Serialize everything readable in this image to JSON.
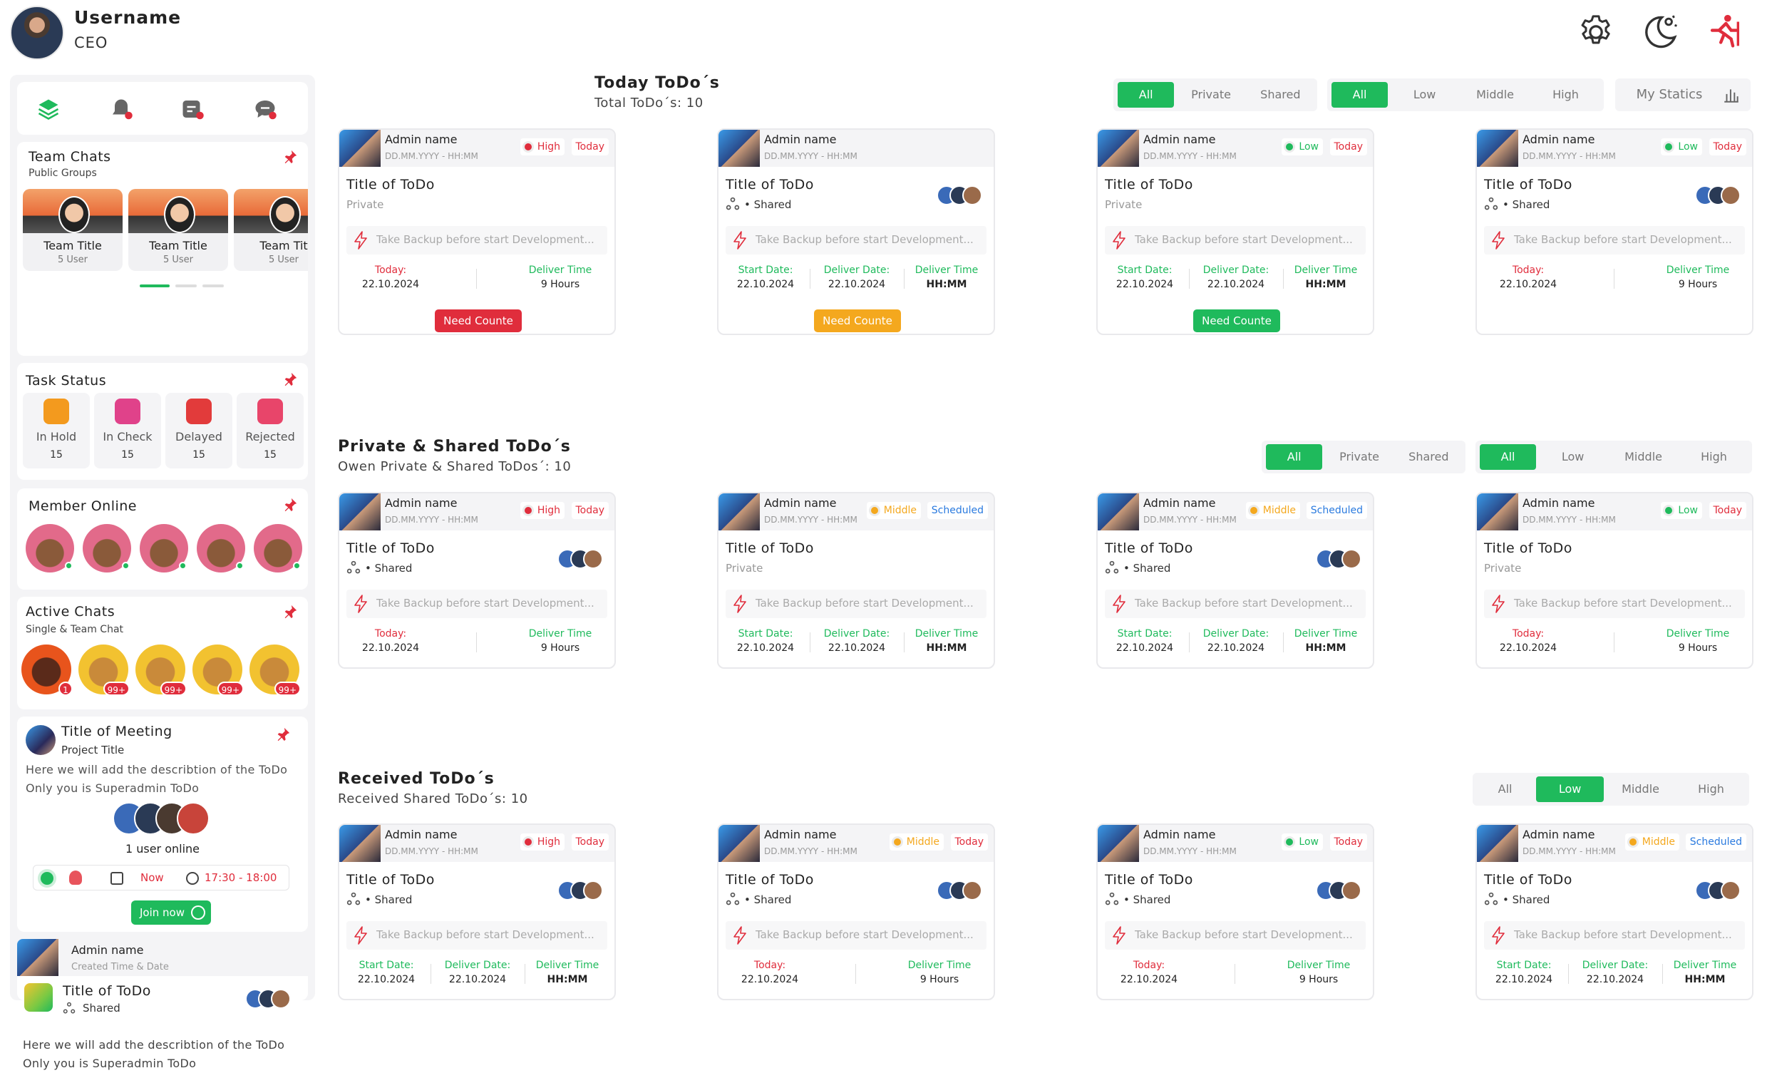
{
  "user": {
    "name": "Username",
    "role": "CEO"
  },
  "top_icons": [
    "gear-icon",
    "moon-theme-icon",
    "logout-run-icon"
  ],
  "sidebar": {
    "nav_icons": [
      "layers-icon",
      "bell-icon",
      "tasks-icon",
      "chat-icon"
    ],
    "team_chats": {
      "title": "Team Chats",
      "subtitle": "Public Groups",
      "cards": [
        {
          "title": "Team Title",
          "users": "5 User"
        },
        {
          "title": "Team Title",
          "users": "5 User"
        },
        {
          "title": "Team Tit",
          "users": "5 User"
        }
      ]
    },
    "task_status": {
      "title": "Task Status",
      "items": [
        {
          "label": "In Hold",
          "count": "15",
          "color": "#f39a1e"
        },
        {
          "label": "In Check",
          "count": "15",
          "color": "#e0428a"
        },
        {
          "label": "Delayed",
          "count": "15",
          "color": "#e23b3b"
        },
        {
          "label": "Rejected",
          "count": "15",
          "color": "#e8456a"
        }
      ]
    },
    "member_online": {
      "title": "Member Online"
    },
    "active_chats": {
      "title": "Active Chats",
      "subtitle": "Single & Team Chat",
      "badges": [
        "1",
        "99+",
        "99+",
        "99+",
        "99+"
      ]
    },
    "meeting": {
      "title": "Title of Meeting",
      "subtitle": "Project Title",
      "description": "Here we will add the describtion of the ToDo Only you is Superadmin ToDo",
      "online": "1 user online",
      "when": "Now",
      "time": "17:30 - 18:00",
      "join_label": "Join now"
    },
    "todo_preview": {
      "admin": "Admin name",
      "created": "Created Time & Date",
      "title": "Title of ToDo",
      "shared": "Shared",
      "description": "Here we will add the describtion of the ToDo Only you is Superadmin ToDo"
    }
  },
  "labels": {
    "admin": "Admin name",
    "date_placeholder": "DD.MM.YYYY - HH:MM",
    "todo_title": "Title of ToDo",
    "private": "Private",
    "shared": "Shared",
    "task": "Take Backup before start Development...",
    "today_k": "Today:",
    "start_k": "Start Date:",
    "deliver_date_k": "Deliver Date:",
    "deliver_time_k": "Deliver Time",
    "date_v": "22.10.2024",
    "hours_v": "9 Hours",
    "hhmm_v": "HH:MM"
  },
  "colors": {
    "green": "#1fba5c",
    "red": "#e02d3c",
    "orange": "#f4a81e",
    "blue": "#2a7adf"
  },
  "today_section": {
    "title": "Today ToDo´s",
    "subtitle": "Total ToDo´s: 10",
    "filter_scope": [
      "All",
      "Private",
      "Shared"
    ],
    "filter_priority": [
      "All",
      "Low",
      "Middle",
      "High"
    ],
    "statics_label": "My Statics",
    "cards": [
      {
        "priority": "High",
        "tag": "Today",
        "visibility": "Private",
        "dates": "today",
        "button": "Need Counte",
        "button_color": "#e02d3c"
      },
      {
        "priority": "",
        "tag": "",
        "visibility": "Shared",
        "dates": "range",
        "button": "Need Counte",
        "button_color": "#f4a81e"
      },
      {
        "priority": "Low",
        "tag": "Today",
        "visibility": "Private",
        "dates": "range",
        "button": "Need Counte",
        "button_color": "#1fba5c"
      },
      {
        "priority": "Low",
        "tag": "Today",
        "visibility": "Shared",
        "dates": "today",
        "button": ""
      }
    ]
  },
  "private_section": {
    "title": "Private & Shared  ToDo´s",
    "subtitle": "Owen Private & Shared ToDos´: 10",
    "filter_scope": [
      "All",
      "Private",
      "Shared"
    ],
    "filter_priority": [
      "All",
      "Low",
      "Middle",
      "High"
    ],
    "cards": [
      {
        "priority": "High",
        "tag": "Today",
        "visibility": "Shared",
        "dates": "today"
      },
      {
        "priority": "Middle",
        "tag": "Scheduled",
        "visibility": "Private",
        "dates": "range"
      },
      {
        "priority": "Middle",
        "tag": "Scheduled",
        "visibility": "Shared",
        "dates": "range"
      },
      {
        "priority": "Low",
        "tag": "Today",
        "visibility": "Private",
        "dates": "today"
      }
    ]
  },
  "received_section": {
    "title": "Received ToDo´s",
    "subtitle": "Received Shared ToDo´s: 10",
    "filter_priority": [
      "All",
      "Low",
      "Middle",
      "High"
    ],
    "cards": [
      {
        "priority": "High",
        "tag": "Today",
        "visibility": "Shared",
        "dates": "range"
      },
      {
        "priority": "Middle",
        "tag": "Today",
        "visibility": "Shared",
        "dates": "today"
      },
      {
        "priority": "Low",
        "tag": "Today",
        "visibility": "Shared",
        "dates": "today"
      },
      {
        "priority": "Middle",
        "tag": "Scheduled",
        "visibility": "Shared",
        "dates": "range"
      }
    ]
  }
}
